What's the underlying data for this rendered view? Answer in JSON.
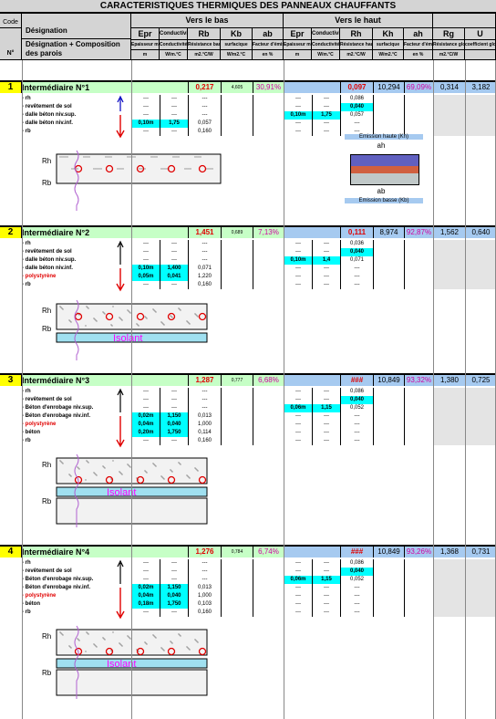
{
  "title": "CARACTERISTIQUES THERMIQUES DES PANNEAUX CHAUFFANTS",
  "header": {
    "code": "Code",
    "n": "N°",
    "designation": "Désignation",
    "designation2": "Désignation + Composition des parois",
    "vers_bas": "Vers le bas",
    "vers_haut": "Vers le haut",
    "cols_bas": [
      "Epr",
      "Conductivit",
      "Rb",
      "Kb",
      "ab"
    ],
    "cols_haut": [
      "Epr",
      "Conductivit",
      "Rh",
      "Kh",
      "ah"
    ],
    "cols_glob": [
      "Rg",
      "U"
    ],
    "sub_bas": [
      "Epaisseur matériau",
      "Conductivité thermique",
      "Résistance basse",
      "surfacique",
      "Facteur d'émission"
    ],
    "sub_haut": [
      "Epaisseur matériau",
      "Conductivité thermique",
      "Résistance haute",
      "surfacique",
      "Facteur d'émission"
    ],
    "sub_glob": [
      "Résistance globale",
      "coefficient global"
    ],
    "units_bas": [
      "m",
      "W/m.°C",
      "m2.°C/W",
      "W/m2.°C",
      "en %"
    ],
    "units_haut": [
      "m",
      "W/m.°C",
      "m2.°C/W",
      "W/m2.°C",
      "en %"
    ],
    "units_glob": [
      "m2.°C/W",
      ""
    ]
  },
  "sections": [
    {
      "num": "1",
      "name": "Intermédiaire N°1",
      "rb": "0,217",
      "kb": "4,605",
      "ab": "30,91%",
      "rh": "0,097",
      "kh": "10,294",
      "ah": "69,09%",
      "rg": "0,314",
      "u": "3,182",
      "rows": [
        {
          "label": "- rh",
          "b": [
            "---",
            "---",
            "---"
          ],
          "h": [
            "---",
            "---",
            "0,086"
          ]
        },
        {
          "label": "- revêtement de sol",
          "b": [
            "---",
            "---",
            "---"
          ],
          "h": [
            "---",
            "---",
            "0,040"
          ]
        },
        {
          "label": "- dalle béton niv.sup.",
          "b": [
            "---",
            "---",
            "---"
          ],
          "h": [
            "0,10m",
            "1,75",
            "0,057"
          ]
        },
        {
          "label": "- dalle béton niv.inf.",
          "b": [
            "0,10m",
            "1,75",
            "0,057"
          ],
          "h": [
            "---",
            "---",
            "---"
          ]
        },
        {
          "label": "- rb",
          "b": [
            "---",
            "---",
            "0,160"
          ],
          "h": [
            "---",
            "---",
            "---"
          ]
        }
      ],
      "legend_top": "Emission haute (Kh)",
      "legend_ah": "ah",
      "legend_ab": "ab",
      "legend_bottom": "Emission basse (Kb)"
    },
    {
      "num": "2",
      "name": "Intermédiaire N°2",
      "rb": "1,451",
      "kb": "0,689",
      "ab": "7,13%",
      "rh": "0,111",
      "kh": "8,974",
      "ah": "92,87%",
      "rg": "1,562",
      "u": "0,640",
      "rows": [
        {
          "label": "- rh",
          "b": [
            "---",
            "---",
            "---"
          ],
          "h": [
            "---",
            "---",
            "0,036"
          ]
        },
        {
          "label": "- revêtement de sol",
          "b": [
            "---",
            "---",
            "---"
          ],
          "h": [
            "---",
            "---",
            "0,040"
          ]
        },
        {
          "label": "- dalle béton niv.sup.",
          "b": [
            "---",
            "---",
            "---"
          ],
          "h": [
            "0,10m",
            "1,4",
            "0,071"
          ]
        },
        {
          "label": "- dalle béton niv.inf.",
          "b": [
            "0,10m",
            "1,400",
            "0,071"
          ],
          "h": [
            "---",
            "---",
            "---"
          ]
        },
        {
          "label": "- polystyrène",
          "b": [
            "0,05m",
            "0,041",
            "1,220"
          ],
          "h": [
            "---",
            "---",
            "---"
          ],
          "red": true
        },
        {
          "label": "- rb",
          "b": [
            "---",
            "---",
            "0,160"
          ],
          "h": [
            "---",
            "---",
            "---"
          ]
        }
      ],
      "isolant": "Isolant"
    },
    {
      "num": "3",
      "name": "Intermédiaire N°3",
      "rb": "1,287",
      "kb": "0,777",
      "ab": "6,68%",
      "rh": "###",
      "kh": "10,849",
      "ah": "93,32%",
      "rg": "1,380",
      "u": "0,725",
      "rows": [
        {
          "label": "- rh",
          "b": [
            "---",
            "---",
            "---"
          ],
          "h": [
            "---",
            "---",
            "0,086"
          ]
        },
        {
          "label": "- revêtement de sol",
          "b": [
            "---",
            "---",
            "---"
          ],
          "h": [
            "---",
            "---",
            "0,040"
          ]
        },
        {
          "label": "- Béton d'enrobage niv.sup.",
          "b": [
            "---",
            "---",
            "---"
          ],
          "h": [
            "0,06m",
            "1,15",
            "0,052"
          ]
        },
        {
          "label": "- Béton d'enrobage niv.inf.",
          "b": [
            "0,02m",
            "1,150",
            "0,013"
          ],
          "h": [
            "---",
            "---",
            "---"
          ]
        },
        {
          "label": "- polystyrène",
          "b": [
            "0,04m",
            "0,040",
            "1,000"
          ],
          "h": [
            "---",
            "---",
            "---"
          ],
          "red": true
        },
        {
          "label": "- béton",
          "b": [
            "0,20m",
            "1,750",
            "0,114"
          ],
          "h": [
            "---",
            "---",
            "---"
          ]
        },
        {
          "label": "- rb",
          "b": [
            "---",
            "---",
            "0,160"
          ],
          "h": [
            "---",
            "---",
            "---"
          ]
        }
      ],
      "isolant": "Isolant"
    },
    {
      "num": "4",
      "name": "Intermédiaire N°4",
      "rb": "1,276",
      "kb": "0,784",
      "ab": "6,74%",
      "rh": "###",
      "kh": "10,849",
      "ah": "93,26%",
      "rg": "1,368",
      "u": "0,731",
      "rows": [
        {
          "label": "- rh",
          "b": [
            "---",
            "---",
            "---"
          ],
          "h": [
            "---",
            "---",
            "0,086"
          ]
        },
        {
          "label": "- revêtement de sol",
          "b": [
            "---",
            "---",
            "---"
          ],
          "h": [
            "---",
            "---",
            "0,040"
          ]
        },
        {
          "label": "- Béton d'enrobage niv.sup.",
          "b": [
            "---",
            "---",
            "---"
          ],
          "h": [
            "0,06m",
            "1,15",
            "0,052"
          ]
        },
        {
          "label": "- Béton d'enrobage niv.inf.",
          "b": [
            "0,02m",
            "1,150",
            "0,013"
          ],
          "h": [
            "---",
            "---",
            "---"
          ]
        },
        {
          "label": "- polystyrène",
          "b": [
            "0,04m",
            "0,040",
            "1,000"
          ],
          "h": [
            "---",
            "---",
            "---"
          ],
          "red": true
        },
        {
          "label": "- béton",
          "b": [
            "0,18m",
            "1,750",
            "0,103"
          ],
          "h": [
            "---",
            "---",
            "---"
          ]
        },
        {
          "label": "- rb",
          "b": [
            "---",
            "---",
            "0,160"
          ],
          "h": [
            "---",
            "---",
            "---"
          ]
        }
      ],
      "isolant": "Isolant"
    }
  ],
  "diagram_labels": {
    "rh": "Rh",
    "rb": "Rb"
  },
  "colors": {
    "yellow": "#ffff00",
    "green": "#c6ffc6",
    "blue": "#a6caf0",
    "cyan": "#00ffff",
    "red": "#e00000",
    "pink": "#d000a0"
  }
}
